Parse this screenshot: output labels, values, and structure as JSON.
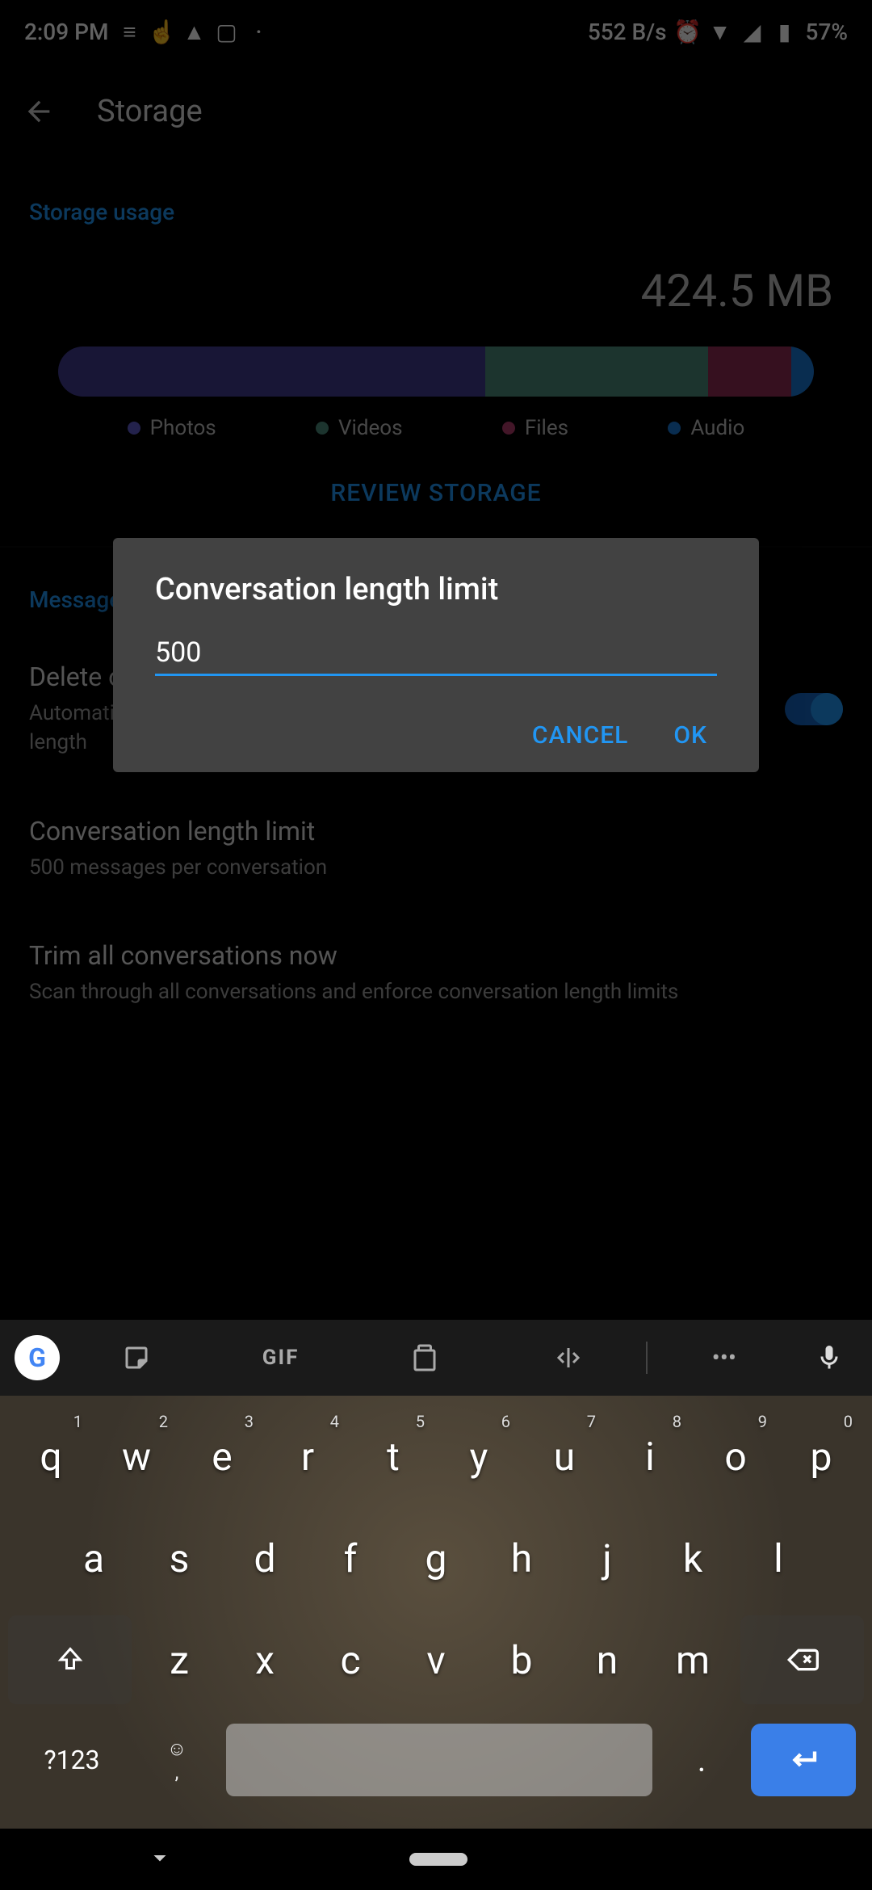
{
  "status": {
    "time": "2:09 PM",
    "net_speed": "552 B/s",
    "battery": "57%"
  },
  "app_bar": {
    "title": "Storage"
  },
  "storage": {
    "section": "Storage usage",
    "total": "424.5 MB",
    "legend": {
      "photos": "Photos",
      "videos": "Videos",
      "files": "Files",
      "audio": "Audio"
    },
    "review": "REVIEW STORAGE"
  },
  "messages": {
    "section": "Messages",
    "delete_title": "Delete old messages",
    "delete_sub": "Automatically delete older messages once a conversation exceeds a specified length",
    "limit_title": "Conversation length limit",
    "limit_sub": "500 messages per conversation",
    "trim_title": "Trim all conversations now",
    "trim_sub": "Scan through all conversations and enforce conversation length limits"
  },
  "dialog": {
    "title": "Conversation length limit",
    "value": "500",
    "cancel": "CANCEL",
    "ok": "OK"
  },
  "keyboard": {
    "gif": "GIF",
    "row1": [
      "q",
      "w",
      "e",
      "r",
      "t",
      "y",
      "u",
      "i",
      "o",
      "p"
    ],
    "hints1": [
      "1",
      "2",
      "3",
      "4",
      "5",
      "6",
      "7",
      "8",
      "9",
      "0"
    ],
    "row2": [
      "a",
      "s",
      "d",
      "f",
      "g",
      "h",
      "j",
      "k",
      "l"
    ],
    "row3": [
      "z",
      "x",
      "c",
      "v",
      "b",
      "n",
      "m"
    ],
    "sym": "?123",
    "comma": ",",
    "period": "."
  }
}
